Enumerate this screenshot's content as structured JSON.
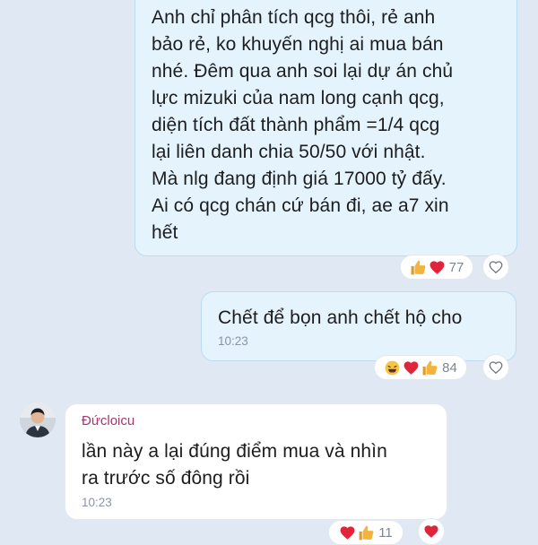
{
  "messages": [
    {
      "text": "Anh chỉ phân tích qcg thôi, rẻ anh\nbảo rẻ, ko khuyến nghị ai mua bán\nnhé. Đêm qua anh soi lại dự án chủ\nlực mizuki của nam long cạnh qcg,\ndiện tích đất thành phẩm =1/4 qcg\nlại liên danh chia 50/50 với nhật.\nMà nlg đang định giá 17000 tỷ đấy.\nAi có qcg chán cứ bán đi, ae a7 xin\nhết",
      "reactions": {
        "icons": [
          "thumbs-up",
          "heart"
        ],
        "count": "77"
      }
    },
    {
      "text": "Chết để bọn anh chết hộ cho",
      "time": "10:23",
      "reactions": {
        "icons": [
          "laughing-face",
          "heart",
          "thumbs-up"
        ],
        "count": "84"
      }
    },
    {
      "sender": "Đứcloicu",
      "text": "lần này a lại đúng điểm mua và nhìn\nra trước số đông rồi",
      "time": "10:23",
      "reactions": {
        "icons": [
          "heart",
          "thumbs-up"
        ],
        "count": "11"
      }
    }
  ],
  "colors": {
    "background": "#dfe8f3",
    "own_bubble": "#e5f3fd",
    "other_bubble": "#ffffff",
    "sender_name": "#a3376c",
    "timestamp": "#8a94a3",
    "heart": "#e0243a",
    "thumbs_up": "#f3b33d"
  }
}
